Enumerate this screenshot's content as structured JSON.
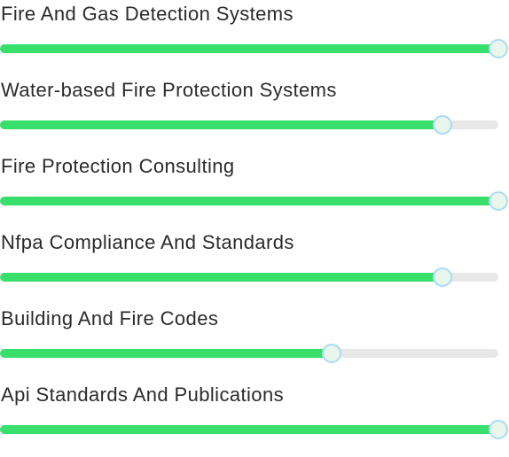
{
  "accent_color": "#38e06b",
  "track_color": "#e8e8e8",
  "handle_border_color": "#a8dcf7",
  "skills": [
    {
      "label": "Fire And Gas Detection Systems",
      "level": 1.0
    },
    {
      "label": "Water-based Fire Protection Systems",
      "level": 0.888
    },
    {
      "label": "Fire Protection Consulting",
      "level": 1.0
    },
    {
      "label": "Nfpa Compliance And Standards",
      "level": 0.888
    },
    {
      "label": "Building And Fire Codes",
      "level": 0.665
    },
    {
      "label": "Api Standards And Publications",
      "level": 1.0
    }
  ]
}
